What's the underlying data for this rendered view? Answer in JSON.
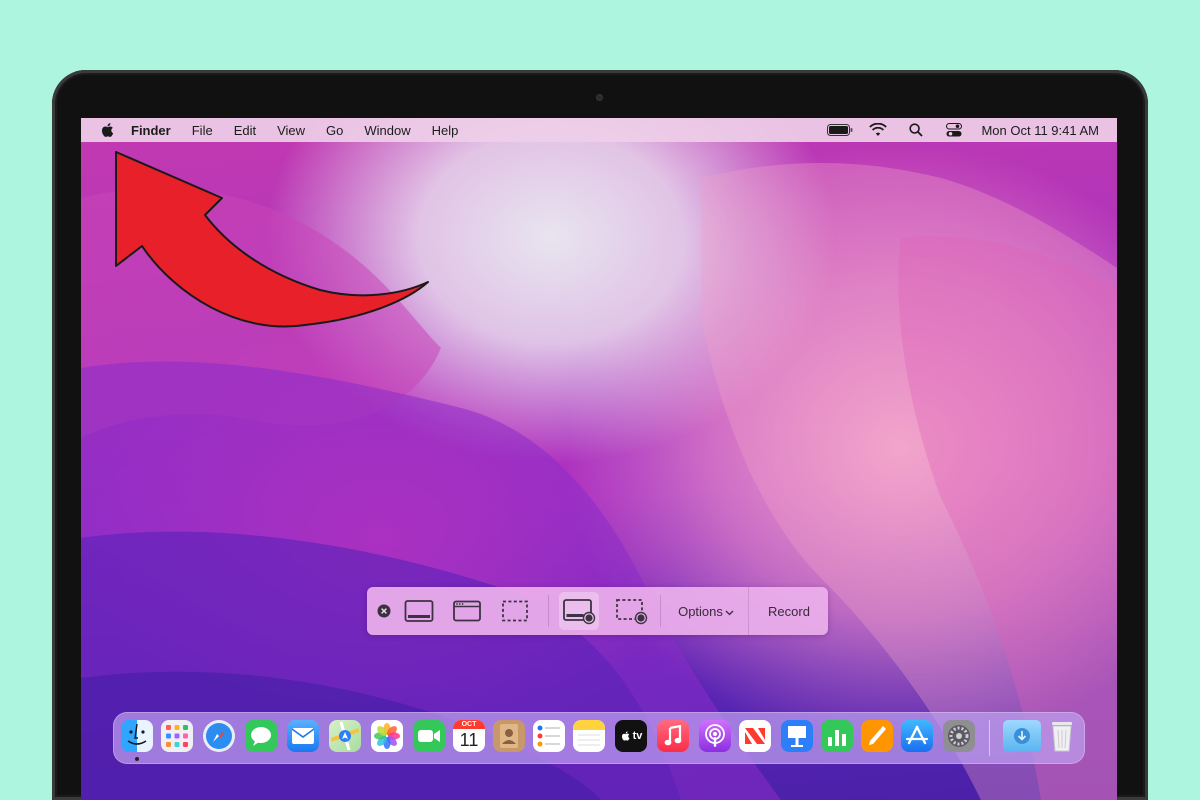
{
  "menubar": {
    "apple_icon": "apple-logo-icon",
    "items": [
      "Finder",
      "File",
      "Edit",
      "View",
      "Go",
      "Window",
      "Help"
    ],
    "status_icons": [
      "battery-icon",
      "wifi-icon",
      "search-icon",
      "control-center-icon"
    ],
    "clock": "Mon Oct 11  9:41 AM"
  },
  "screenshot_toolbar": {
    "tools": [
      "close-icon",
      "capture-entire-screen-icon",
      "capture-window-icon",
      "capture-selection-icon",
      "record-entire-screen-icon",
      "record-selection-icon"
    ],
    "options_label": "Options",
    "record_label": "Record"
  },
  "dock": {
    "apps": [
      "Finder",
      "Launchpad",
      "Safari",
      "Messages",
      "Mail",
      "Maps",
      "Photos",
      "FaceTime",
      "Calendar",
      "Contacts",
      "Reminders",
      "Notes",
      "TV",
      "Music",
      "Podcasts",
      "News",
      "Keynote",
      "Numbers",
      "Pages",
      "App Store",
      "System Preferences",
      "Downloads",
      "Trash"
    ],
    "calendar_month": "OCT",
    "calendar_day": "11",
    "tv_label": "tv"
  },
  "colors": {
    "background": "#aef5df",
    "annotation_arrow": "#e8202a",
    "menubar": "#eecee8",
    "toolbar": "#ecb0ec"
  }
}
